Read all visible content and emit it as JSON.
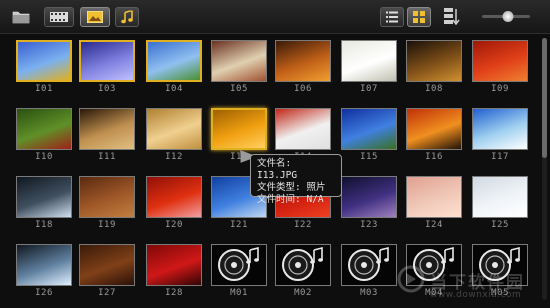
{
  "toolbar": {
    "folder_icon": "folder-icon",
    "view_buttons": [
      {
        "icon": "film-icon",
        "active": false
      },
      {
        "icon": "photo-icon",
        "active": true
      },
      {
        "icon": "music-icon",
        "active": false
      }
    ],
    "layout_buttons": [
      {
        "icon": "list-view-icon",
        "active": false
      },
      {
        "icon": "grid-view-icon",
        "active": true
      }
    ],
    "sort_icon": "sort-download-icon",
    "zoom_level": 0.55
  },
  "thumbnails": [
    {
      "name": "I01",
      "selected": true,
      "colors": [
        "#3a5fd0",
        "#7ab0f0",
        "#e0b020"
      ]
    },
    {
      "name": "I03",
      "selected": true,
      "colors": [
        "#2a2a90",
        "#8080e0",
        "#c0c0ff"
      ]
    },
    {
      "name": "I04",
      "selected": true,
      "colors": [
        "#3a70d0",
        "#90c0f0",
        "#4a9030"
      ]
    },
    {
      "name": "I05",
      "selected": false,
      "colors": [
        "#6a3020",
        "#e0d0b0",
        "#a05030"
      ]
    },
    {
      "name": "I06",
      "selected": false,
      "colors": [
        "#3a1a08",
        "#c06018",
        "#f0a030"
      ]
    },
    {
      "name": "I07",
      "selected": false,
      "colors": [
        "#e8e8e0",
        "#ffffff",
        "#c0c0b0"
      ]
    },
    {
      "name": "I08",
      "selected": false,
      "colors": [
        "#1a1008",
        "#805018",
        "#d09030"
      ]
    },
    {
      "name": "I09",
      "selected": false,
      "colors": [
        "#a01808",
        "#e04018",
        "#f08030"
      ]
    },
    {
      "name": "I10",
      "selected": false,
      "colors": [
        "#2a5010",
        "#609028",
        "#a02018"
      ]
    },
    {
      "name": "I11",
      "selected": false,
      "colors": [
        "#2a1808",
        "#c09050",
        "#e0c080"
      ]
    },
    {
      "name": "I12",
      "selected": false,
      "colors": [
        "#b08030",
        "#f0d090",
        "#c09040"
      ]
    },
    {
      "name": "I13",
      "selected": false,
      "hover": true,
      "colors": [
        "#a06000",
        "#f0a010",
        "#ffd060"
      ]
    },
    {
      "name": "I14",
      "selected": false,
      "colors": [
        "#c02818",
        "#f0f0f0",
        "#e0e0e0"
      ]
    },
    {
      "name": "I15",
      "selected": false,
      "colors": [
        "#1030a0",
        "#4080e0",
        "#3a7020"
      ]
    },
    {
      "name": "I16",
      "selected": false,
      "colors": [
        "#c03008",
        "#f09020",
        "#201008"
      ]
    },
    {
      "name": "I17",
      "selected": false,
      "colors": [
        "#2060d0",
        "#a0d0f0",
        "#ffffff"
      ]
    },
    {
      "name": "I18",
      "selected": false,
      "colors": [
        "#101820",
        "#405060",
        "#d0e0f0"
      ]
    },
    {
      "name": "I19",
      "selected": false,
      "colors": [
        "#5a2a10",
        "#a05828",
        "#c08040"
      ]
    },
    {
      "name": "I20",
      "selected": false,
      "colors": [
        "#901008",
        "#e03010",
        "#f0a0a0"
      ]
    },
    {
      "name": "I21",
      "selected": false,
      "colors": [
        "#1040a0",
        "#4080e0",
        "#c0d8f0"
      ]
    },
    {
      "name": "I22",
      "selected": false,
      "colors": [
        "#a01008",
        "#d02010",
        "#f04020"
      ]
    },
    {
      "name": "I23",
      "selected": false,
      "colors": [
        "#101030",
        "#403080",
        "#a080c0"
      ]
    },
    {
      "name": "I24",
      "selected": false,
      "colors": [
        "#e0a090",
        "#f0c8b8",
        "#ffe0d0"
      ]
    },
    {
      "name": "I25",
      "selected": false,
      "colors": [
        "#d0d8e0",
        "#f0f4f8",
        "#ffffff"
      ]
    },
    {
      "name": "I26",
      "selected": false,
      "colors": [
        "#101820",
        "#6080a0",
        "#e0f0ff"
      ]
    },
    {
      "name": "I27",
      "selected": false,
      "colors": [
        "#3a1a08",
        "#804018",
        "#2a1008"
      ]
    },
    {
      "name": "I28",
      "selected": false,
      "colors": [
        "#800808",
        "#d01818",
        "#300404"
      ]
    },
    {
      "name": "M01",
      "selected": false,
      "music": true
    },
    {
      "name": "M02",
      "selected": false,
      "music": true
    },
    {
      "name": "M03",
      "selected": false,
      "music": true
    },
    {
      "name": "M04",
      "selected": false,
      "music": true
    },
    {
      "name": "M05",
      "selected": false,
      "music": true
    }
  ],
  "tooltip": {
    "line1": "文件名: I13.JPG",
    "line2": "文件类型: 照片",
    "line3": "文件时间: N/A"
  },
  "scroll_position": 0.0,
  "watermark": {
    "text": "当下软件园",
    "url": "www.downxia.com"
  }
}
